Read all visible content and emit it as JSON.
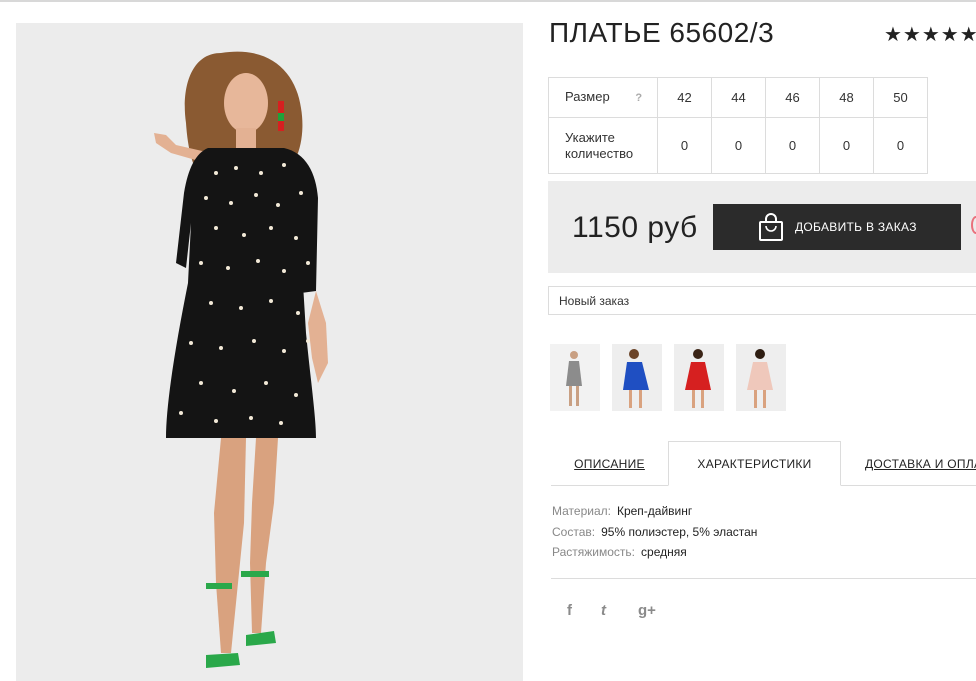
{
  "product": {
    "title": "ПЛАТЬЕ 65602/3",
    "stars": "★★★★★",
    "rating": 5
  },
  "size_table": {
    "size_label": "Размер",
    "help": "?",
    "sizes": [
      "42",
      "44",
      "46",
      "48",
      "50"
    ],
    "qty_label_1": "Укажите",
    "qty_label_2": "количество",
    "quantities": [
      "0",
      "0",
      "0",
      "0",
      "0"
    ]
  },
  "order": {
    "price": "1150 руб",
    "add_button": "ДОБАВИТЬ В ЗАКАЗ",
    "select_value": "Новый заказ"
  },
  "thumbnails": [
    {
      "icon": "dress-thumb-grey",
      "color": "#8c8c8c"
    },
    {
      "icon": "dress-thumb-blue",
      "color": "#1f4fc2"
    },
    {
      "icon": "dress-thumb-red",
      "color": "#d62020"
    },
    {
      "icon": "dress-thumb-pink",
      "color": "#efc8bb"
    }
  ],
  "tabs": [
    {
      "label": "ОПИСАНИЕ",
      "active": false
    },
    {
      "label": "ХАРАКТЕРИСТИКИ",
      "active": true
    },
    {
      "label": "ДОСТАВКА И ОПЛАТА",
      "active": false
    }
  ],
  "specs": [
    {
      "key": "Материал:",
      "value": "Креп-дайвинг"
    },
    {
      "key": "Состав:",
      "value": "95% полиэстер, 5% эластан"
    },
    {
      "key": "Растяжимость:",
      "value": "средняя"
    }
  ],
  "social": {
    "facebook": "f",
    "twitter": "t",
    "google": "g+"
  },
  "colors": {
    "button_bg": "#2b2b2b",
    "panel_bg": "#ececec",
    "border": "#dcdcdc"
  }
}
